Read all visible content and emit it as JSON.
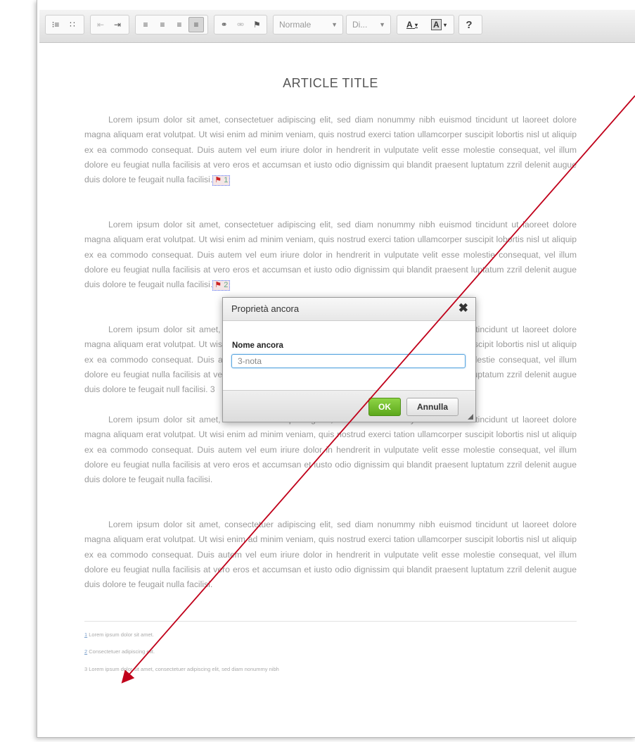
{
  "toolbar": {
    "buttons": [
      {
        "icon": "numbered-list-icon",
        "glyph": "⁝≡"
      },
      {
        "icon": "bulleted-list-icon",
        "glyph": "∷"
      },
      {
        "icon": "outdent-icon",
        "glyph": "⇤"
      },
      {
        "icon": "indent-icon",
        "glyph": "⇥"
      },
      {
        "icon": "align-left-icon",
        "glyph": "≡"
      },
      {
        "icon": "align-center-icon",
        "glyph": "≡"
      },
      {
        "icon": "align-right-icon",
        "glyph": "≡"
      },
      {
        "icon": "align-justify-icon",
        "glyph": "≡"
      },
      {
        "icon": "link-icon",
        "glyph": "⚭"
      },
      {
        "icon": "unlink-icon",
        "glyph": "⚮"
      },
      {
        "icon": "anchor-flag-icon",
        "glyph": "⚑"
      }
    ],
    "format_select": "Normale",
    "size_select": "Di...",
    "text_color_glyph": "A",
    "bg_color_glyph": "A",
    "help_glyph": "?"
  },
  "article": {
    "title": "ARTICLE TITLE",
    "paragraph_1": "Lorem ipsum dolor sit amet, consectetuer adipiscing elit, sed diam nonummy nibh euismod tincidunt ut laoreet dolore magna aliquam erat volutpat. Ut wisi enim ad minim veniam, quis nostrud exerci tation ullamcorper suscipit lobortis nisl ut aliquip ex ea commodo consequat. Duis autem vel eum iriure dolor in hendrerit in vulputate velit esse molestie consequat, vel illum dolore eu feugiat nulla facilisis at vero eros et accumsan et iusto odio dignissim qui blandit praesent luptatum zzril delenit augue duis dolore te feugait nulla facilisi.",
    "anchor_1": "1",
    "paragraph_2": "Lorem ipsum dolor sit amet, consectetuer adipiscing elit, sed diam nonummy nibh euismod tincidunt ut laoreet dolore magna aliquam erat volutpat. Ut wisi enim ad minim veniam, quis nostrud exerci tation ullamcorper suscipit lobortis nisl ut aliquip ex ea commodo consequat. Duis autem vel eum iriure dolor in hendrerit in vulputate velit esse molestie consequat, vel illum dolore eu feugiat nulla facilisis at vero eros et accumsan et iusto odio dignissim qui blandit praesent luptatum zzril delenit augue duis dolore te feugait nulla facilisi.",
    "anchor_2": "2",
    "paragraph_3": "Lorem ipsum dolor sit amet, consectetuer adipiscing elit, sed diam nonummy nibh euismod tincidunt ut laoreet dolore magna aliquam erat volutpat. Ut wisi enim ad minim veniam, quis nostrud exerci tation ullamcorper suscipit lobortis nisl ut aliquip ex ea commodo consequat. Duis autem vel eum iriure dolor in hendrerit in vulputate velit esse molestie consequat, vel illum dolore eu feugiat nulla facilisis at vero eros et accumsan et iusto odio dignissim qui blandit praesent luptatum zzril delenit augue duis dolore te feugait null facilisi. 3",
    "paragraph_4": "Lorem ipsum dolor sit amet, consectetuer adipiscing elit, sed diam nonummy nibh euismod tincidunt ut laoreet dolore magna aliquam erat volutpat. Ut wisi enim ad minim veniam, quis nostrud exerci tation ullamcorper suscipit lobortis nisl ut aliquip ex ea commodo consequat. Duis autem vel eum iriure dolor in hendrerit in vulputate velit esse molestie consequat, vel illum dolore eu feugiat nulla facilisis at vero eros et accumsan et iusto odio dignissim qui blandit praesent luptatum zzril delenit augue duis dolore te feugait nulla facilisi.",
    "paragraph_5": "Lorem ipsum dolor sit amet, consectetuer adipiscing elit, sed diam nonummy nibh euismod tincidunt ut laoreet dolore magna aliquam erat volutpat. Ut wisi enim ad minim veniam, quis nostrud exerci tation ullamcorper suscipit lobortis nisl ut aliquip ex ea commodo consequat. Duis autem vel eum iriure dolor in hendrerit in vulputate velit esse molestie consequat, vel illum dolore eu feugiat nulla facilisis at vero eros et accumsan et iusto odio dignissim qui blandit praesent luptatum zzril delenit augue duis dolore te feugait nulla facilisi."
  },
  "footnotes": [
    {
      "num": "1",
      "text": "Lorem ipsum dolor sit amet."
    },
    {
      "num": "2",
      "text": "Consectetuer adipiscing elit."
    },
    {
      "num": "3",
      "text": "Lorem ipsum dolor sit amet, consectetuer adipiscing elit, sed diam nonummy nibh"
    }
  ],
  "dialog": {
    "title": "Proprietà ancora",
    "close_glyph": "✖",
    "field_label": "Nome ancora",
    "field_value": "3-nota",
    "ok_label": "OK",
    "cancel_label": "Annulla"
  },
  "colors": {
    "annotation_arrow": "#c0001a",
    "ok_button": "#6ab82a",
    "input_focus": "#5aa6e0"
  }
}
